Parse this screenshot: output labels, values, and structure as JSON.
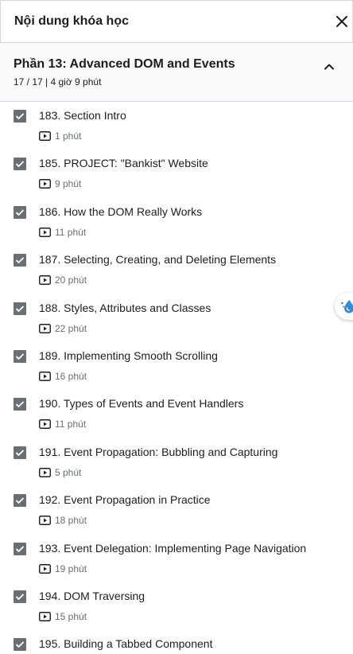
{
  "header": {
    "title": "Nội dung khóa học",
    "close_icon": "close-icon"
  },
  "section": {
    "title": "Phần 13: Advanced DOM and Events",
    "meta": "17 / 17 | 4 giờ 9 phút",
    "expanded": true,
    "toggle_icon": "chevron-up-icon"
  },
  "lectures": [
    {
      "title": "183. Section Intro",
      "duration": "1 phút",
      "completed": true
    },
    {
      "title": "185. PROJECT: \"Bankist\" Website",
      "duration": "9 phút",
      "completed": true
    },
    {
      "title": "186. How the DOM Really Works",
      "duration": "11 phút",
      "completed": true
    },
    {
      "title": "187. Selecting, Creating, and Deleting Elements",
      "duration": "20 phút",
      "completed": true
    },
    {
      "title": "188. Styles, Attributes and Classes",
      "duration": "22 phút",
      "completed": true
    },
    {
      "title": "189. Implementing Smooth Scrolling",
      "duration": "16 phút",
      "completed": true
    },
    {
      "title": "190. Types of Events and Event Handlers",
      "duration": "11 phút",
      "completed": true
    },
    {
      "title": "191. Event Propagation: Bubbling and Capturing",
      "duration": "5 phút",
      "completed": true
    },
    {
      "title": "192. Event Propagation in Practice",
      "duration": "18 phút",
      "completed": true
    },
    {
      "title": "193. Event Delegation: Implementing Page Navigation",
      "duration": "19 phút",
      "completed": true
    },
    {
      "title": "194. DOM Traversing",
      "duration": "15 phút",
      "completed": true
    },
    {
      "title": "195. Building a Tabbed Component",
      "duration": "",
      "completed": true
    }
  ],
  "icons": {
    "checkbox": "checkbox-checked-icon",
    "video": "video-play-icon",
    "extension": "water-drop-icon"
  },
  "colors": {
    "checkbox": "#6a6f73",
    "section_bg": "#f7f9fa",
    "border": "#d1d7dc",
    "text": "#1c1d1f",
    "muted": "#6a6f73",
    "extension_blue": "#2f8bdc"
  }
}
